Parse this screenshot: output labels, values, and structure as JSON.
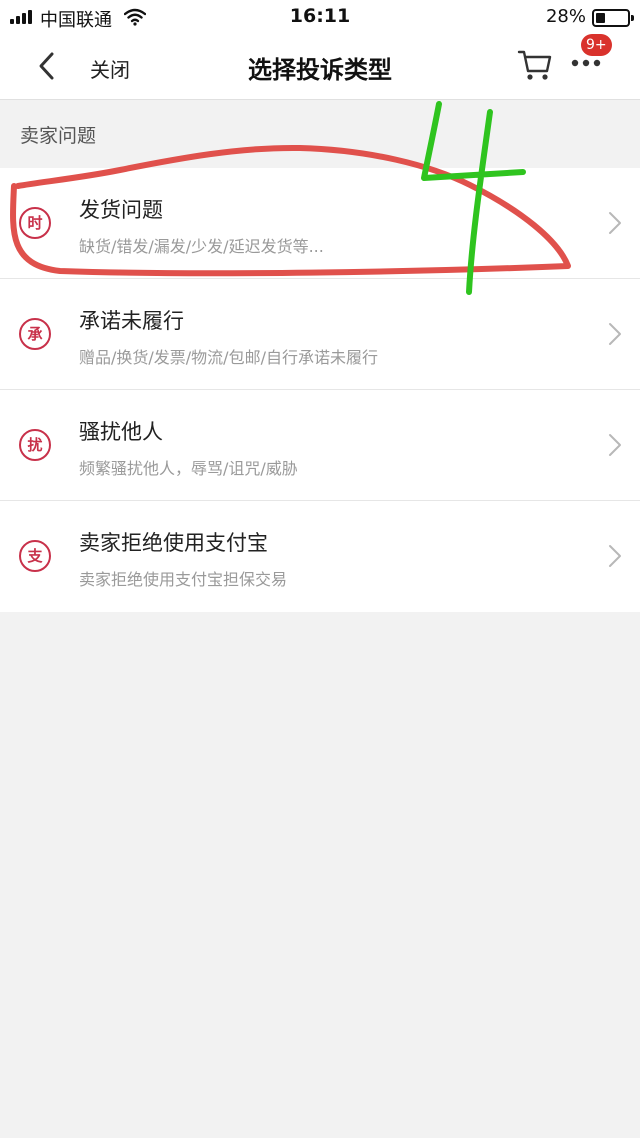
{
  "status_bar": {
    "carrier": "中国联通",
    "time": "16:11",
    "battery": "28%",
    "battery_level": 0.28
  },
  "nav": {
    "close_label": "关闭",
    "title": "选择投诉类型",
    "badge": "9+"
  },
  "section": {
    "title": "卖家问题"
  },
  "items": [
    {
      "icon_char": "时",
      "title": "发货问题",
      "subtitle": "缺货/错发/漏发/少发/延迟发货等..."
    },
    {
      "icon_char": "承",
      "title": "承诺未履行",
      "subtitle": "赠品/换货/发票/物流/包邮/自行承诺未履行"
    },
    {
      "icon_char": "扰",
      "title": "骚扰他人",
      "subtitle": "频繁骚扰他人，辱骂/诅咒/威胁"
    },
    {
      "icon_char": "支",
      "title": "卖家拒绝使用支付宝",
      "subtitle": "卖家拒绝使用支付宝担保交易"
    }
  ],
  "annotation": {
    "handwritten_text": "4",
    "circle_color": "#e0514c",
    "text_color": "#2fc41f"
  },
  "colors": {
    "accent": "#c8314a",
    "badge": "#d9322c"
  }
}
